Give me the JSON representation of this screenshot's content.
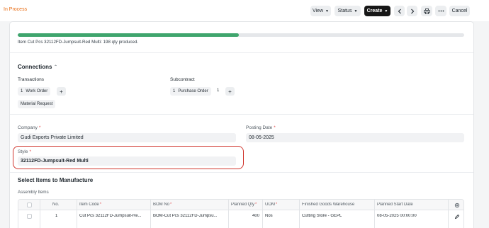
{
  "header": {
    "status": "In Process",
    "view_label": "View",
    "status_label": "Status",
    "create_label": "Create",
    "cancel_label": "Cancel"
  },
  "progress": {
    "fraction": 0.495,
    "message": "Item Cut Pcs 32112FD-Jumpsuit-Red Multi: 198 qty produced."
  },
  "connections": {
    "title": "Connections",
    "transactions_label": "Transactions",
    "subcontract_label": "Subcontract",
    "work_order": {
      "count": "1",
      "label": "Work Order"
    },
    "material_request": {
      "label": "Material Request"
    },
    "purchase_order": {
      "count": "1",
      "label": "Purchase Order",
      "count2": "1"
    }
  },
  "form": {
    "company_label": "Company",
    "company_value": "Gudi Exports Private Limited",
    "posting_date_label": "Posting Date",
    "posting_date_value": "08-05-2025",
    "style_label": "Style",
    "style_value": "32112FD-Jumpsuit-Red Multi",
    "required_mark": "*"
  },
  "items_section": {
    "title": "Select Items to Manufacture",
    "table_label": "Assembly Items",
    "columns": {
      "no": "No.",
      "item_code": "Item Code",
      "bom_no": "BOM No",
      "planned_qty": "Planned Qty",
      "uom": "UOM",
      "warehouse": "Finished Goods Warehouse",
      "start_date": "Planned Start Date"
    },
    "rows": [
      {
        "no": "1",
        "item_code": "Cut Pcs 32112FD-Jumpsuit-Re...",
        "bom_no": "BOM-Cut Pcs 32112FD-Jumpsu...",
        "planned_qty": "400",
        "uom": "Nos",
        "warehouse": "Cutting Store - GEPL",
        "start_date": "08-05-2025 00:00:00"
      }
    ]
  },
  "colors": {
    "status": "#e86c13",
    "progress": "#3fa56d",
    "highlight": "#d0342c",
    "primary_button": "#171717"
  },
  "icons": {
    "prev": "chevron-left-icon",
    "next": "chevron-right-icon",
    "print": "printer-icon",
    "more": "ellipsis-icon",
    "collapse": "chevron-up-icon",
    "settings": "gear-icon",
    "edit": "pencil-icon"
  }
}
